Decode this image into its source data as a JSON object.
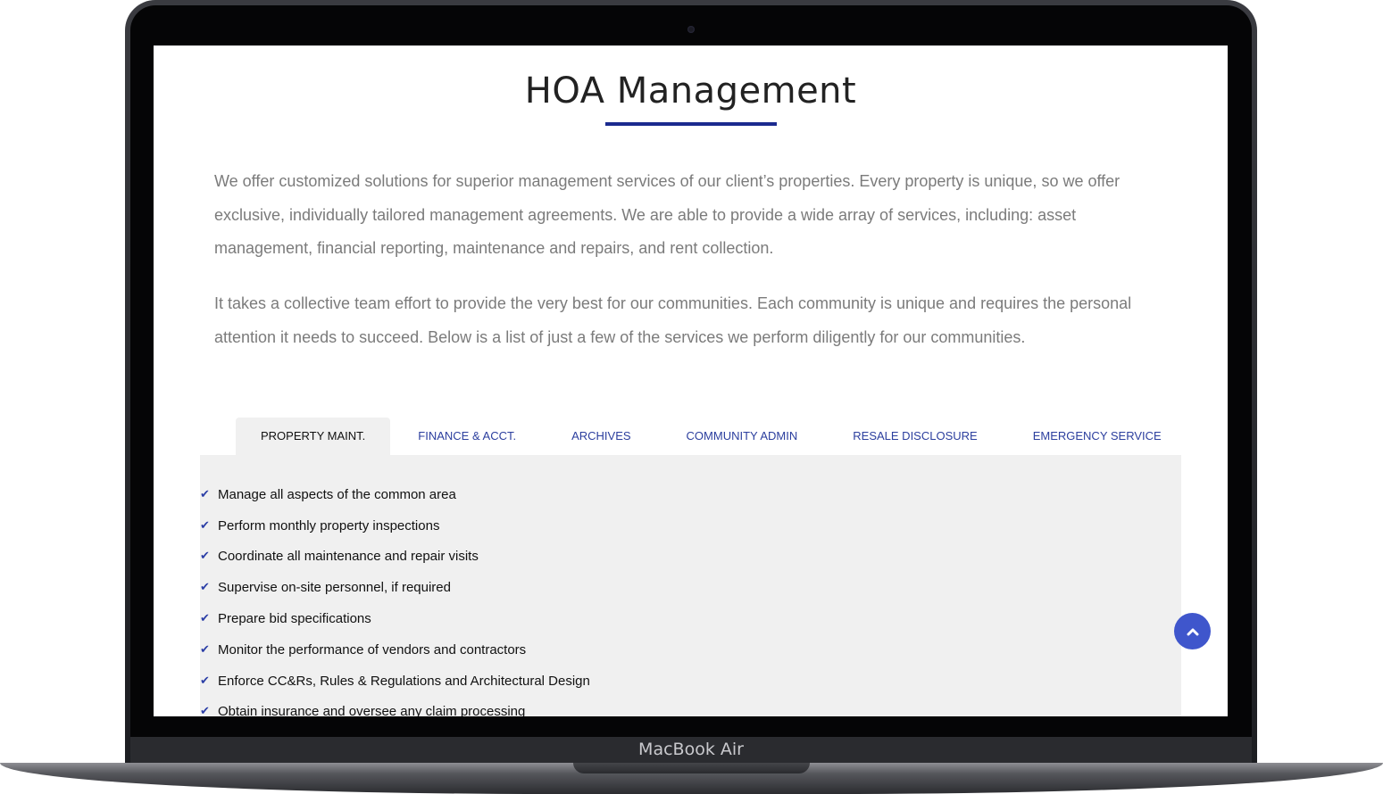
{
  "device": {
    "label": "MacBook Air"
  },
  "page": {
    "title": "HOA Management",
    "paragraphs": [
      "We offer customized solutions for superior management services of our client’s properties. Every property is unique, so we offer exclusive, individually tailored management agreements. We are able to provide a wide array of services, including: asset management, financial reporting, maintenance and repairs, and rent collection.",
      "It takes a collective team effort to provide the very best for our communities. Each community is unique and requires the personal attention it needs to succeed. Below is a list of just a few of the services we perform diligently for our communities."
    ]
  },
  "tabs": [
    {
      "label": "PROPERTY MAINT.",
      "active": true
    },
    {
      "label": "FINANCE & ACCT.",
      "active": false
    },
    {
      "label": "ARCHIVES",
      "active": false
    },
    {
      "label": "COMMUNITY ADMIN",
      "active": false
    },
    {
      "label": "RESALE DISCLOSURE",
      "active": false
    },
    {
      "label": "EMERGENCY SERVICE",
      "active": false
    }
  ],
  "features": [
    "Manage all aspects of the common area",
    "Perform monthly property inspections",
    "Coordinate all maintenance and repair visits",
    "Supervise on-site personnel, if required",
    "Prepare bid specifications",
    "Monitor the performance of vendors and contractors",
    "Enforce CC&Rs, Rules & Regulations and Architectural Design",
    "Obtain insurance and oversee any claim processing"
  ],
  "icons": {
    "check": "check-icon",
    "scroll_top": "chevron-up-icon"
  },
  "colors": {
    "accent": "#1b2a8f",
    "tab_link": "#2b3e9e",
    "scroll_button": "#3f56cc",
    "panel_bg": "#f0f0f0"
  }
}
